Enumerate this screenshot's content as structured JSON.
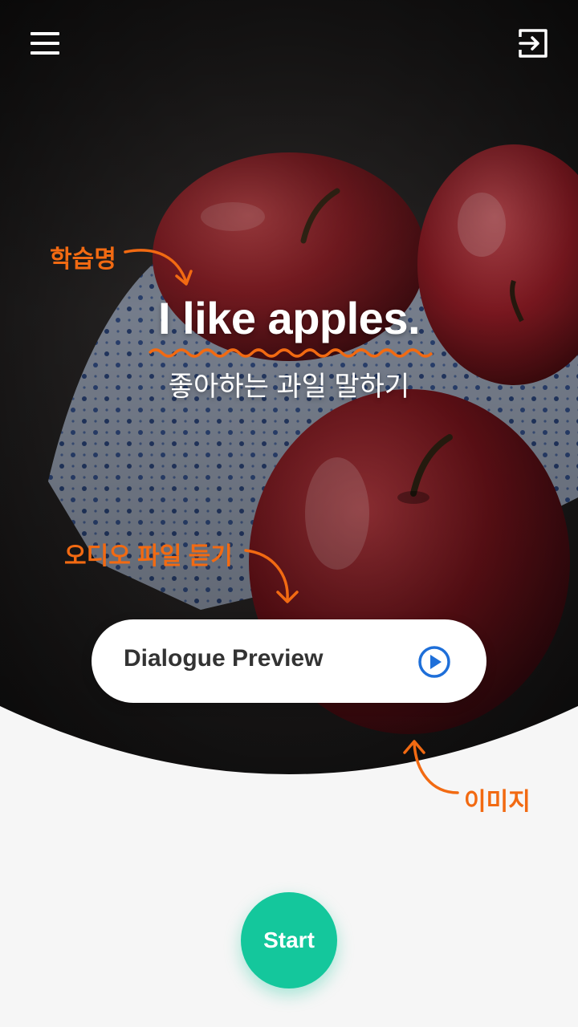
{
  "lesson": {
    "title": "I like apples.",
    "subtitle": "좋아하는 과일 말하기"
  },
  "header": {
    "menu_icon": "hamburger-menu-icon",
    "exit_icon": "exit-icon"
  },
  "preview": {
    "label": "Dialogue Preview",
    "icon": "play-circle-icon"
  },
  "start": {
    "label": "Start"
  },
  "annotations": {
    "title_note": "학습명",
    "audio_note": "오디오 파일 듣기",
    "image_note": "이미지"
  },
  "colors": {
    "accent_orange": "#f26a12",
    "start_green": "#14c79c",
    "play_blue": "#1e6fd9",
    "background": "#f6f6f6"
  }
}
